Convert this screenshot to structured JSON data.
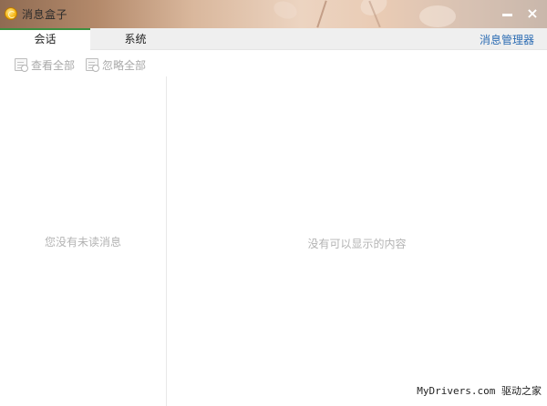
{
  "window": {
    "title": "消息盒子",
    "icon": "app-logo-icon",
    "minimize_icon": "minimize-icon",
    "close_symbol": "×"
  },
  "tabs": [
    {
      "label": "会话",
      "active": true
    },
    {
      "label": "系统",
      "active": false
    }
  ],
  "manager_link": "消息管理器",
  "toolbar": {
    "view_all_label": "查看全部",
    "ignore_all_label": "忽略全部"
  },
  "left_panel": {
    "empty_text": "您没有未读消息"
  },
  "right_panel": {
    "empty_text": "没有可以显示的内容"
  },
  "watermark": "MyDrivers.com 驱动之家",
  "colors": {
    "active_tab_accent": "#3c8f3f",
    "link": "#2c6cb3",
    "muted_text": "#b3b3b3"
  }
}
